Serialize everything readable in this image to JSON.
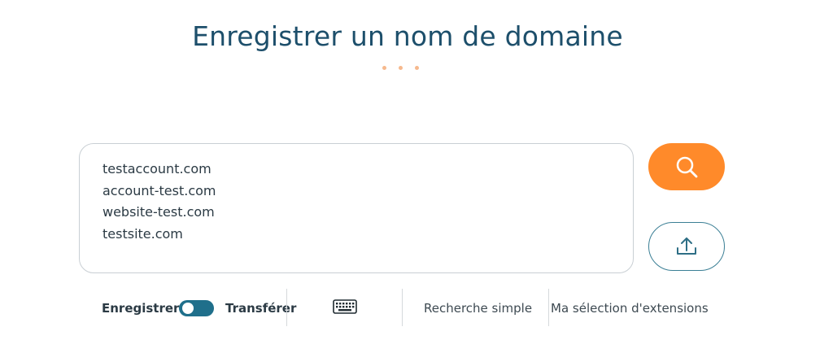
{
  "page": {
    "title": "Enregistrer un nom de domaine"
  },
  "search": {
    "domains": [
      "testaccount.com",
      "account-test.com",
      "website-test.com",
      "testsite.com"
    ]
  },
  "buttons": {
    "search_icon": "magnifier-icon",
    "upload_icon": "upload-icon"
  },
  "options": {
    "register_label": "Enregistrer",
    "transfer_label": "Transférer",
    "keyboard_icon": "keyboard-icon",
    "simple_search_label": "Recherche simple",
    "extensions_label": "Ma sélection d'extensions"
  },
  "colors": {
    "title": "#1d4f6b",
    "accent": "#ff8a2a",
    "toggle": "#1f6f8b",
    "dots": "#f6b98d"
  }
}
